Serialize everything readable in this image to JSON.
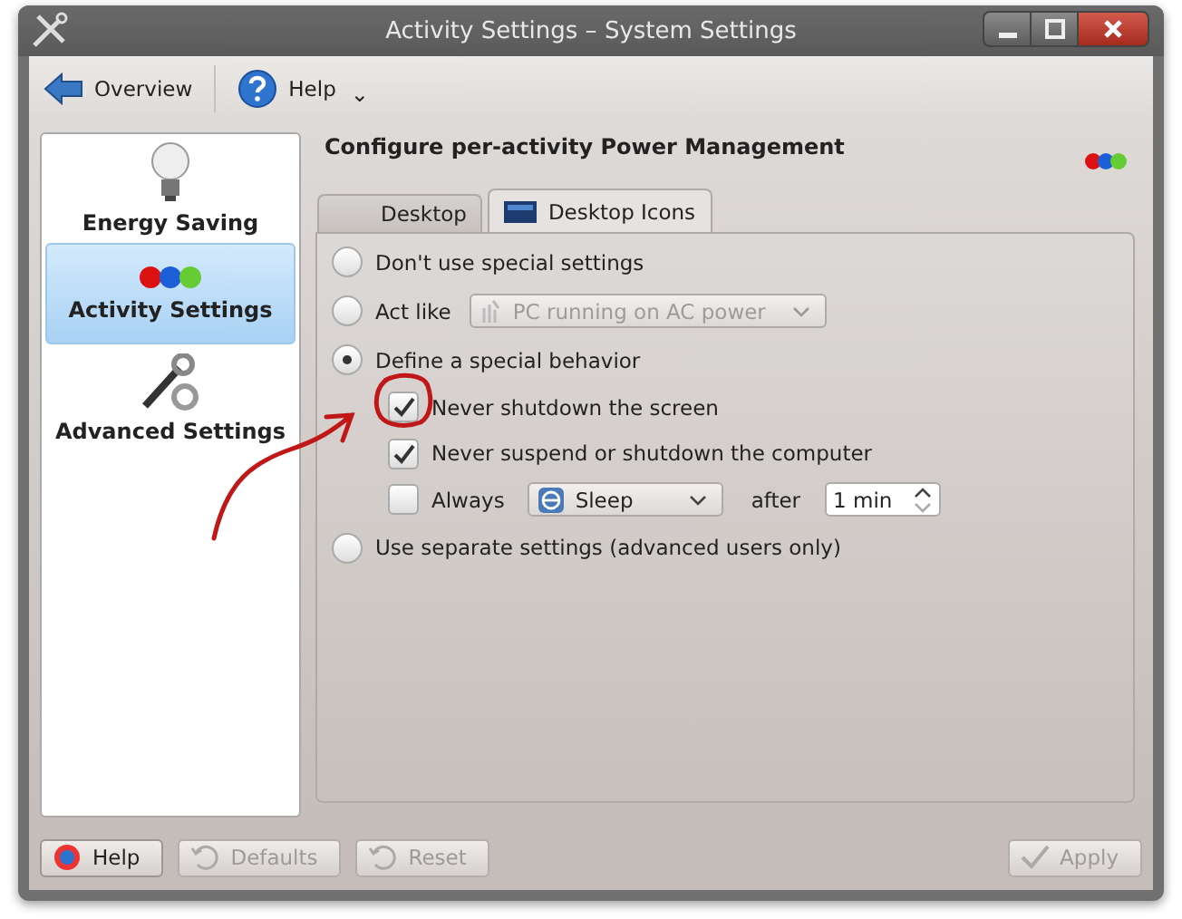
{
  "window": {
    "title": "Activity Settings – System Settings"
  },
  "toolbar": [
    {
      "label": "Overview"
    },
    {
      "label": "Help",
      "dropdown": "⌄"
    }
  ],
  "sidebar": {
    "items": [
      {
        "label": "Energy Saving",
        "selected": false
      },
      {
        "label": "Activity Settings",
        "selected": true
      },
      {
        "label": "Advanced Settings",
        "selected": false
      }
    ]
  },
  "heading": "Configure per-activity Power Management",
  "tabs": [
    {
      "label": "Desktop",
      "selected": false
    },
    {
      "label": "Desktop Icons",
      "selected": true
    }
  ],
  "options": [
    {
      "kind": "plain",
      "label": "Don't use special settings",
      "selected": false
    },
    {
      "kind": "combo",
      "label": "Act like",
      "selected": false,
      "combo": {
        "value": "PC running on AC power",
        "disabled": true
      }
    },
    {
      "kind": "group",
      "label": "Define a special behavior",
      "selected": true,
      "checks": [
        {
          "kind": "plain",
          "label": "Never shutdown the screen",
          "checked": true
        },
        {
          "kind": "plain",
          "label": "Never suspend or shutdown the computer",
          "checked": true
        },
        {
          "kind": "action",
          "label": "Always",
          "checked": false,
          "action": "Sleep",
          "after": "after",
          "duration": "1 min"
        }
      ]
    },
    {
      "kind": "plain",
      "label": "Use separate settings (advanced users only)",
      "selected": false
    }
  ],
  "buttons": [
    {
      "label": "Help",
      "disabled": false
    },
    {
      "label": "Defaults",
      "disabled": true
    },
    {
      "label": "Reset",
      "disabled": true
    },
    {
      "label": "Apply",
      "disabled": true
    }
  ]
}
